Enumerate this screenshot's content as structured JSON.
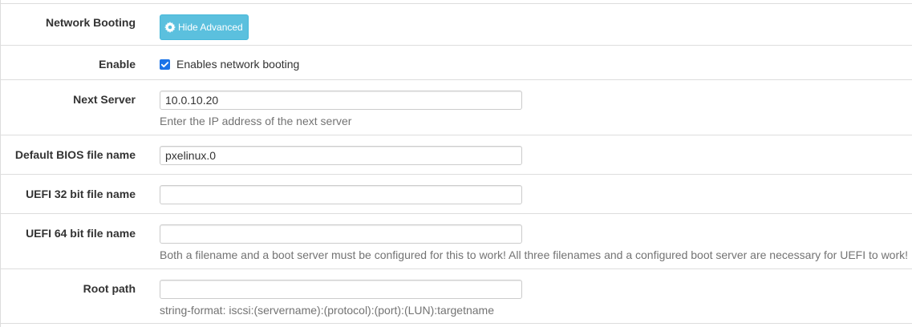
{
  "rows": [
    {
      "label": "Network Booting",
      "button_label": "Hide Advanced",
      "button_icon": "gear-icon"
    },
    {
      "label": "Enable",
      "checkbox_checked": true,
      "checkbox_label": "Enables network booting"
    },
    {
      "label": "Next Server",
      "value": "10.0.10.20",
      "help": "Enter the IP address of the next server"
    },
    {
      "label": "Default BIOS file name",
      "value": "pxelinux.0"
    },
    {
      "label": "UEFI 32 bit file name",
      "value": ""
    },
    {
      "label": "UEFI 64 bit file name",
      "value": "",
      "help": "Both a filename and a boot server must be configured for this to work! All three filenames and a configured boot server are necessary for UEFI to work!"
    },
    {
      "label": "Root path",
      "value": "",
      "help": "string-format: iscsi:(servername):(protocol):(port):(LUN):targetname"
    }
  ],
  "colors": {
    "button_bg": "#5bc0de",
    "checkbox": "#1a73e8",
    "help_text": "#737373",
    "divider": "#dddddd"
  }
}
